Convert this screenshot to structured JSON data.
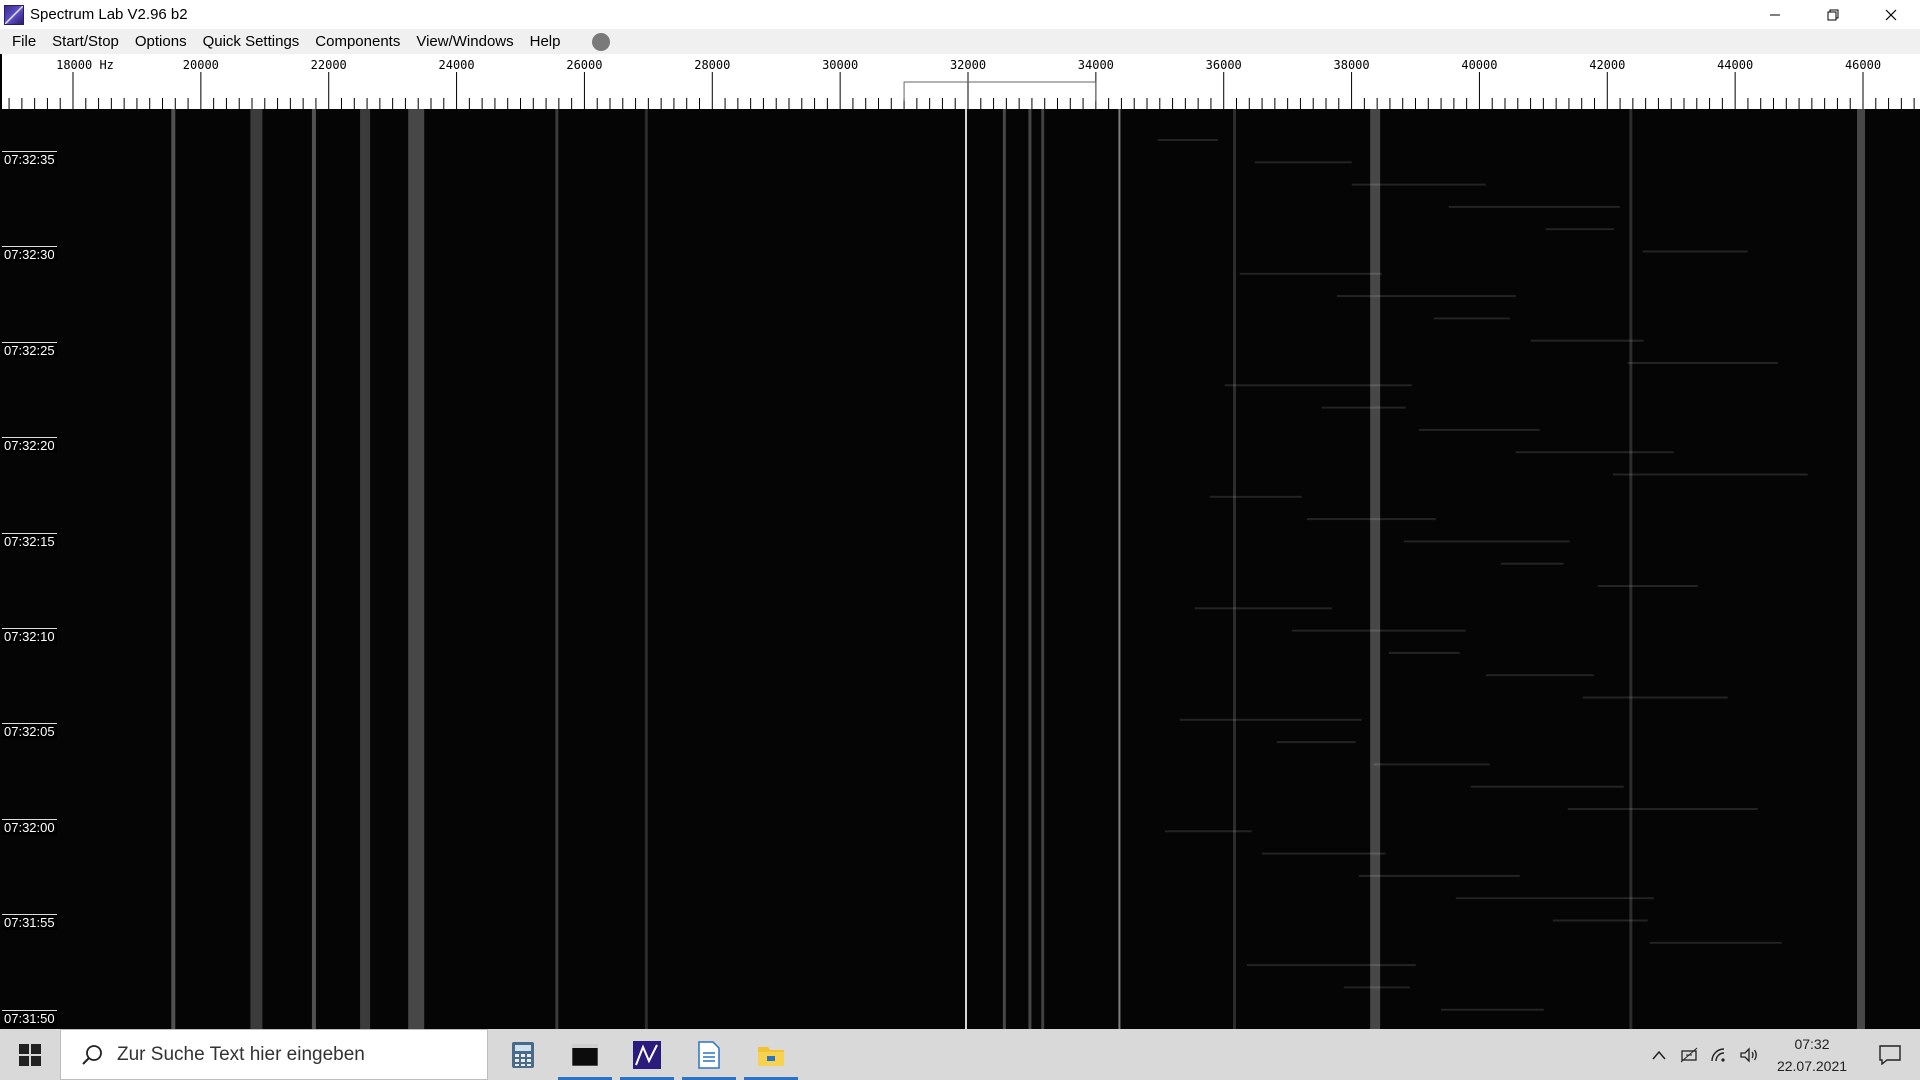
{
  "window": {
    "title": "Spectrum Lab V2.96 b2"
  },
  "menu": {
    "items": [
      {
        "key": "file",
        "label": "File"
      },
      {
        "key": "startstop",
        "label": "Start/Stop"
      },
      {
        "key": "options",
        "label": "Options"
      },
      {
        "key": "quick",
        "label": "Quick Settings"
      },
      {
        "key": "components",
        "label": "Components"
      },
      {
        "key": "view",
        "label": "View/Windows"
      },
      {
        "key": "help",
        "label": "Help"
      }
    ]
  },
  "frequency_scale": {
    "unit_label": "Hz",
    "first_label": "18000 Hz",
    "labels": [
      "20000",
      "22000",
      "24000",
      "26000",
      "28000",
      "30000",
      "32000",
      "34000",
      "36000",
      "38000",
      "40000",
      "42000",
      "44000",
      "46000"
    ],
    "range_hz": [
      17000,
      47000
    ],
    "marker_hz": 32000
  },
  "waterfall": {
    "time_labels": [
      "07:32:35",
      "07:32:30",
      "07:32:25",
      "07:32:20",
      "07:32:15",
      "07:32:10",
      "07:32:05",
      "07:32:00",
      "07:31:55",
      "07:31:50"
    ],
    "signal_lines_hz": [
      19600,
      20900,
      21800,
      22600,
      23400,
      25600,
      27000,
      32000,
      32600,
      33000,
      33200,
      34400,
      36200,
      38400,
      42400,
      46000
    ]
  },
  "taskbar": {
    "search_placeholder": "Zur Suche Text hier eingeben",
    "apps": [
      "calculator-app",
      "terminal-app",
      "spectrum-lab-app",
      "document-app",
      "file-explorer-app"
    ],
    "clock_time": "07:32",
    "clock_date": "22.07.2021"
  },
  "colors": {
    "waterfall_bg": "#050505",
    "signal": "#e0e0e0",
    "taskbar_bg": "#d9d9d9",
    "active_indicator": "#2a73c5"
  }
}
